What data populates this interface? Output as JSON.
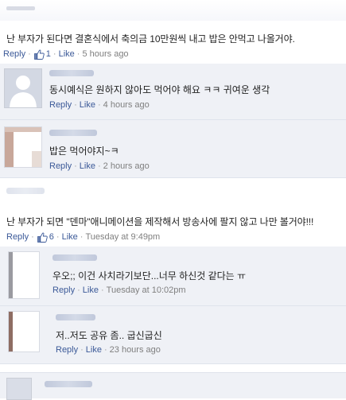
{
  "thread1": {
    "post_text": "난 부자가 된다면 결혼식에서 축의금 10만원씩 내고 밥은 안먹고 나올거야.",
    "reply_label": "Reply",
    "like_count": "1",
    "like_label": "Like",
    "timestamp": "5 hours ago"
  },
  "replies1": [
    {
      "text": "동시예식은 원하지 않아도 먹어야 해요 ㅋㅋ 귀여운 생각",
      "reply_label": "Reply",
      "like_label": "Like",
      "timestamp": "4 hours ago"
    },
    {
      "text": "밥은 먹어야지~ㅋ",
      "reply_label": "Reply",
      "like_label": "Like",
      "timestamp": "2 hours ago"
    }
  ],
  "thread2": {
    "post_text": "난 부자가 되면 \"덴마\"애니메이션을 제작해서 방송사에 팔지 않고 나만 볼거야!!!",
    "reply_label": "Reply",
    "like_count": "6",
    "like_label": "Like",
    "timestamp": "Tuesday at 9:49pm"
  },
  "replies2": [
    {
      "text": "우오;; 이건 사치라기보단...너무 하신것 같다는 ㅠ",
      "reply_label": "Reply",
      "like_label": "Like",
      "timestamp": "Tuesday at 10:02pm"
    },
    {
      "text": "저..저도 공유 좀.. 굽신굽신",
      "reply_label": "Reply",
      "like_label": "Like",
      "timestamp": "23 hours ago"
    }
  ],
  "colors": {
    "link": "#3b5998",
    "meta": "#7f7f7f",
    "reply_bg": "#eff1f6"
  },
  "icons": {
    "like": "thumbs-up-icon"
  }
}
